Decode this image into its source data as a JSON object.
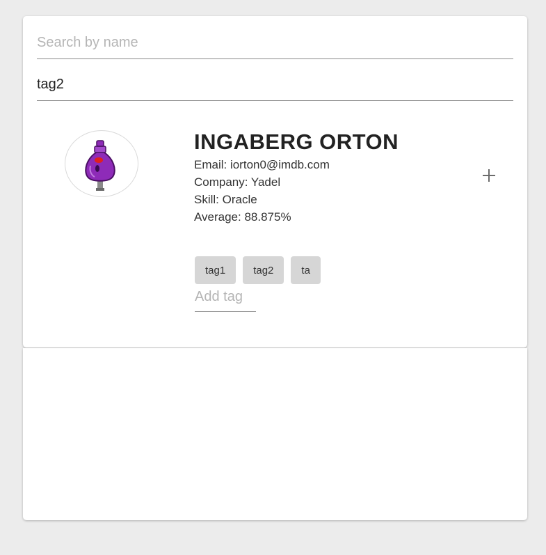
{
  "search": {
    "name_placeholder": "Search by name",
    "name_value": "",
    "tag_placeholder": "",
    "tag_value": "tag2"
  },
  "student": {
    "name": "INGABERG ORTON",
    "email": "Email: iorton0@imdb.com",
    "company": "Company: Yadel",
    "skill": "Skill: Oracle",
    "average": "Average: 88.875%",
    "tags": [
      "tag1",
      "tag2",
      "ta"
    ],
    "add_tag_placeholder": "Add tag",
    "add_tag_value": "",
    "expand_icon": "plus-icon",
    "avatar_color": "#8e2bb8"
  }
}
